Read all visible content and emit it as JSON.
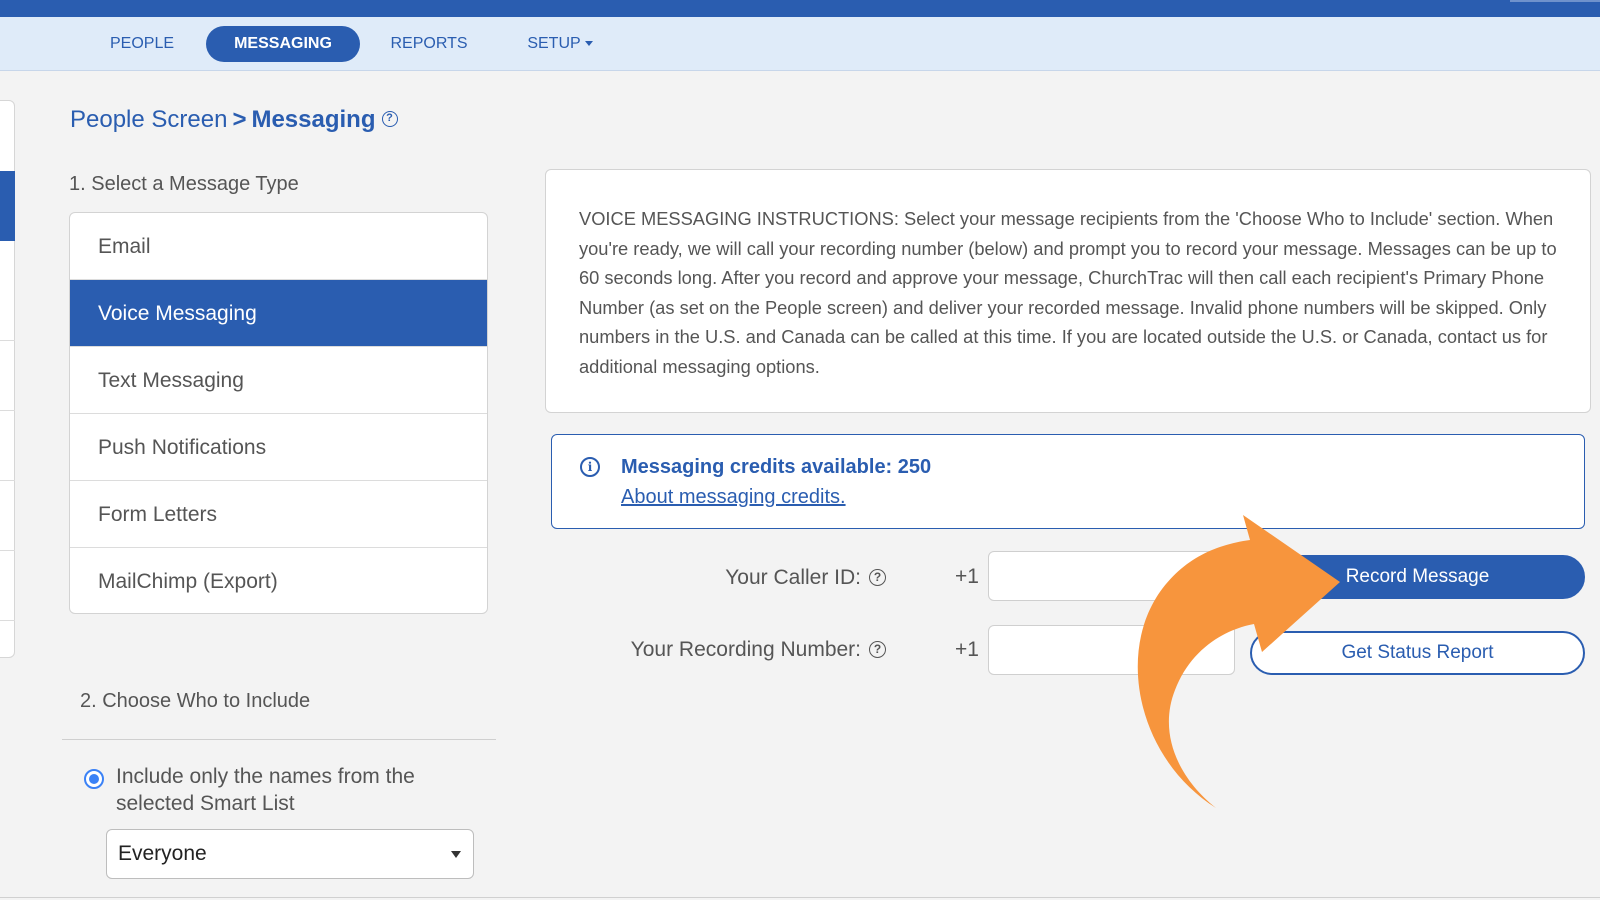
{
  "nav": {
    "items": [
      {
        "label": "PEOPLE"
      },
      {
        "label": "MESSAGING"
      },
      {
        "label": "REPORTS"
      },
      {
        "label": "SETUP"
      }
    ],
    "active": "MESSAGING"
  },
  "breadcrumb": {
    "parent": "People Screen",
    "current": "Messaging",
    "separator": ">"
  },
  "help_glyph": "?",
  "step1": {
    "label": "1. Select a Message Type",
    "types": [
      {
        "label": "Email"
      },
      {
        "label": "Voice Messaging"
      },
      {
        "label": "Text Messaging"
      },
      {
        "label": "Push Notifications"
      },
      {
        "label": "Form Letters"
      },
      {
        "label": "MailChimp (Export)"
      }
    ],
    "selected": "Voice Messaging"
  },
  "step2": {
    "label": "2. Choose Who to Include",
    "radio_label": "Include only the names from the selected Smart List",
    "smart_list_value": "Everyone"
  },
  "instructions": {
    "text": "VOICE MESSAGING INSTRUCTIONS: Select your message recipients from the 'Choose Who to Include' section. When you're ready, we will call your recording number (below) and prompt you to record your message. Messages can be up to 60 seconds long. After you record and approve your message, ChurchTrac will then call each recipient's Primary Phone Number (as set on the People screen) and deliver your recorded message. Invalid phone numbers will be skipped. Only numbers in the U.S. and Canada can be called at this time. If you are located outside the U.S. or Canada, contact us for additional messaging options."
  },
  "credits": {
    "icon": "info-icon",
    "glyph": "i",
    "title": "Messaging credits available: 250",
    "link": "About messaging credits."
  },
  "caller_id": {
    "label": "Your Caller ID:",
    "prefix": "+1",
    "value": ""
  },
  "recording_number": {
    "label": "Your Recording Number:",
    "prefix": "+1",
    "value": ""
  },
  "buttons": {
    "record": "Record Message",
    "status": "Get Status Report"
  },
  "colors": {
    "primary": "#2a5db0",
    "nav_background": "#dfebf9",
    "page_background": "#f3f3f3",
    "annotation_arrow": "#f7953d"
  }
}
